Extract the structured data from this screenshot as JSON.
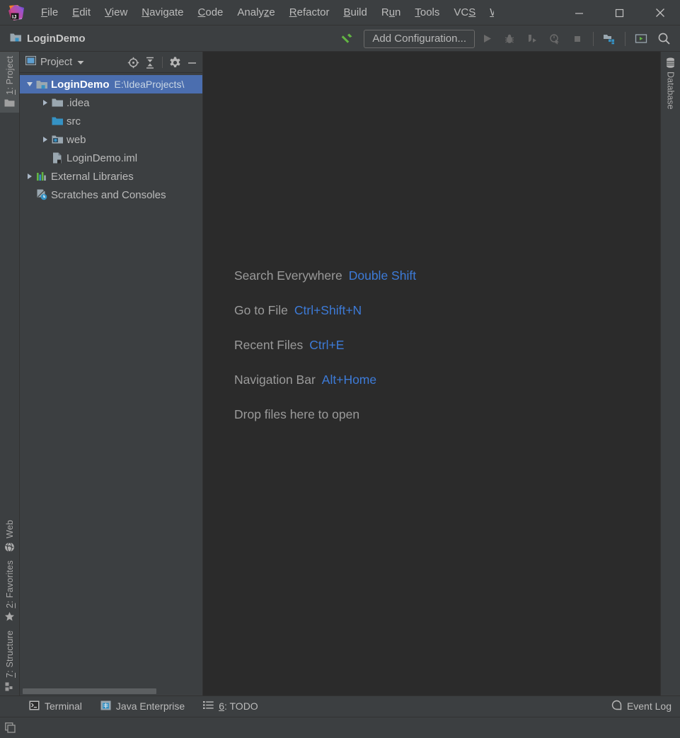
{
  "window": {
    "title": "LoginDemo",
    "minimize_label": "Minimize",
    "maximize_label": "Maximize",
    "close_label": "Close"
  },
  "menubar": {
    "items": [
      {
        "label": "File",
        "mnemonic": "F"
      },
      {
        "label": "Edit",
        "mnemonic": "E"
      },
      {
        "label": "View",
        "mnemonic": "V"
      },
      {
        "label": "Navigate",
        "mnemonic": "N"
      },
      {
        "label": "Code",
        "mnemonic": "C"
      },
      {
        "label": "Analyze",
        "mnemonic": "z"
      },
      {
        "label": "Refactor",
        "mnemonic": "R"
      },
      {
        "label": "Build",
        "mnemonic": "B"
      },
      {
        "label": "Run",
        "mnemonic": "u"
      },
      {
        "label": "Tools",
        "mnemonic": "T"
      },
      {
        "label": "VCS",
        "mnemonic": "S"
      },
      {
        "label": "W",
        "mnemonic": "W"
      }
    ]
  },
  "toolbar": {
    "project_name": "LoginDemo",
    "build_icon": "hammer-icon",
    "configuration_label": "Add Configuration...",
    "run_label": "Run",
    "debug_label": "Debug",
    "run_coverage_label": "Run with Coverage",
    "profile_label": "Profile",
    "stop_label": "Stop",
    "project_structure_label": "Project Structure",
    "terminal_label": "Terminal",
    "search_label": "Search Everywhere"
  },
  "project_panel": {
    "title": "Project",
    "actions": [
      {
        "name": "select-opened-file",
        "label": "Select Opened File"
      },
      {
        "name": "collapse-all",
        "label": "Collapse All"
      },
      {
        "name": "settings",
        "label": "Settings"
      },
      {
        "name": "hide",
        "label": "Hide"
      }
    ],
    "tree": [
      {
        "label": "LoginDemo",
        "path": "E:\\IdeaProjects\\",
        "icon": "project-folder-icon",
        "indent": 0,
        "expanded": true,
        "arrow": "down",
        "selected": true
      },
      {
        "label": ".idea",
        "path": "",
        "icon": "folder-icon",
        "indent": 1,
        "expanded": false,
        "arrow": "right",
        "selected": false
      },
      {
        "label": "src",
        "path": "",
        "icon": "source-folder-icon",
        "indent": 1,
        "expanded": false,
        "arrow": "none",
        "selected": false
      },
      {
        "label": "web",
        "path": "",
        "icon": "web-folder-icon",
        "indent": 1,
        "expanded": false,
        "arrow": "right",
        "selected": false
      },
      {
        "label": "LoginDemo.iml",
        "path": "",
        "icon": "iml-file-icon",
        "indent": 1,
        "expanded": false,
        "arrow": "none",
        "selected": false
      },
      {
        "label": "External Libraries",
        "path": "",
        "icon": "libraries-icon",
        "indent": 0,
        "expanded": false,
        "arrow": "right",
        "selected": false
      },
      {
        "label": "Scratches and Consoles",
        "path": "",
        "icon": "scratches-icon",
        "indent": 0,
        "expanded": false,
        "arrow": "none",
        "selected": false
      }
    ]
  },
  "left_stripe": {
    "top": [
      {
        "label": "1: Project",
        "mnemonic": "1",
        "icon": "folder-icon",
        "active": true
      }
    ],
    "bottom": [
      {
        "label": "Web",
        "mnemonic": "",
        "icon": "globe-icon",
        "active": false
      },
      {
        "label": "2: Favorites",
        "mnemonic": "2",
        "icon": "star-icon",
        "active": false
      },
      {
        "label": "7: Structure",
        "mnemonic": "7",
        "icon": "structure-icon",
        "active": false
      }
    ]
  },
  "right_stripe": {
    "items": [
      {
        "label": "Database",
        "icon": "database-icon"
      }
    ]
  },
  "editor": {
    "hints": [
      {
        "label": "Search Everywhere",
        "key": "Double Shift"
      },
      {
        "label": "Go to File",
        "key": "Ctrl+Shift+N"
      },
      {
        "label": "Recent Files",
        "key": "Ctrl+E"
      },
      {
        "label": "Navigation Bar",
        "key": "Alt+Home"
      },
      {
        "label": "Drop files here to open",
        "key": ""
      }
    ]
  },
  "statusbar": {
    "left": [
      {
        "label": "Terminal",
        "icon": "terminal-icon",
        "mnemonic": ""
      },
      {
        "label": "Java Enterprise",
        "icon": "java-enterprise-icon",
        "mnemonic": ""
      },
      {
        "label": "6: TODO",
        "icon": "todo-icon",
        "mnemonic": "6"
      }
    ],
    "right": {
      "label": "Event Log",
      "icon": "event-log-icon"
    }
  },
  "colors": {
    "window_bg": "#3c3f41",
    "editor_bg": "#2b2b2b",
    "selection": "#4b6eaf",
    "text": "#bbbbbb",
    "hint_key": "#3d7bd8",
    "accent_green": "#499c54",
    "folder_blue": "#5e9fd0"
  }
}
